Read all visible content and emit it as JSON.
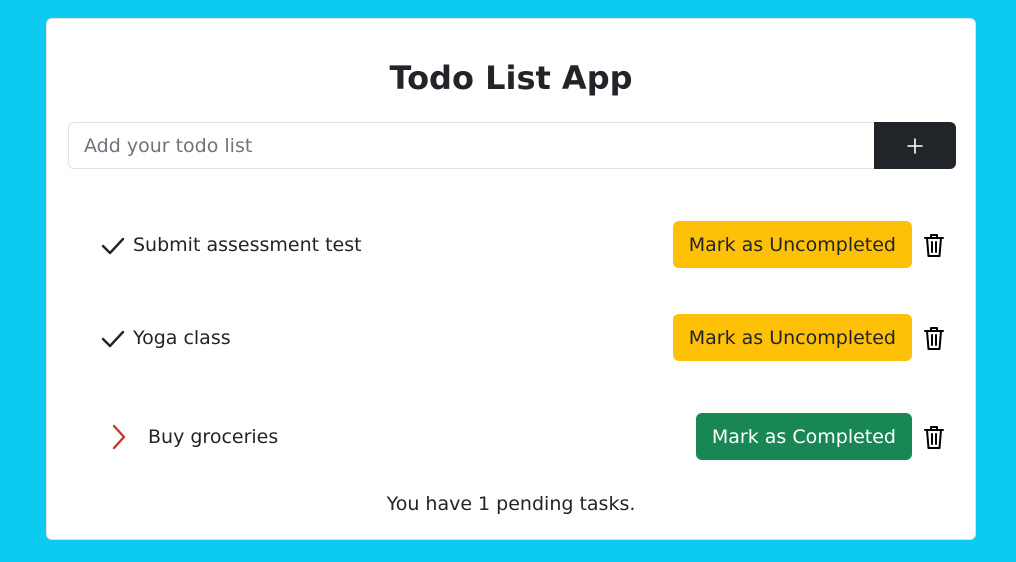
{
  "app": {
    "title": "Todo List App"
  },
  "input": {
    "placeholder": "Add your todo list",
    "value": "",
    "add_icon": "plus-icon"
  },
  "todos": [
    {
      "text": "Submit assessment test",
      "completed": true,
      "status_icon": "checkmark-icon",
      "action_label": "Mark as Uncompleted",
      "action_color": "#ffc107"
    },
    {
      "text": "Yoga class",
      "completed": true,
      "status_icon": "checkmark-icon",
      "action_label": "Mark as Uncompleted",
      "action_color": "#ffc107"
    },
    {
      "text": "Buy groceries",
      "completed": false,
      "status_icon": "chevron-right-icon",
      "action_label": "Mark as Completed",
      "action_color": "#198754"
    }
  ],
  "footer": {
    "pending_text": "You have 1 pending tasks."
  },
  "colors": {
    "background": "#0dcaf0",
    "warning": "#ffc107",
    "success": "#198754",
    "dark": "#212529",
    "chevron": "#c0392b"
  }
}
